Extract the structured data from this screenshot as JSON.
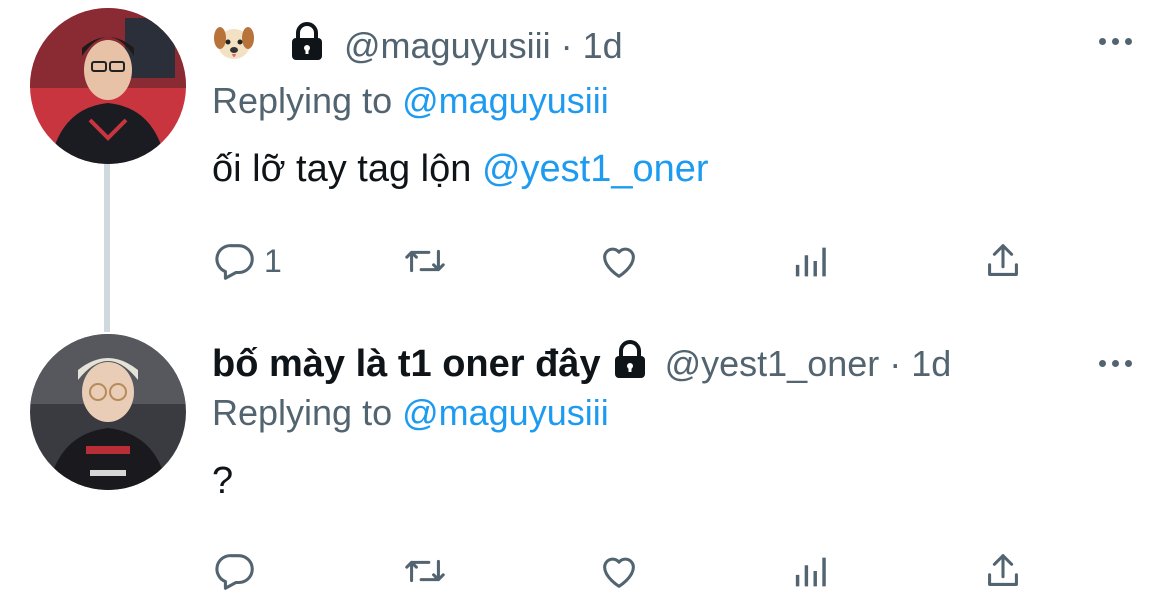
{
  "tweets": [
    {
      "display_name": "",
      "handle": "@maguyusiii",
      "time_sep": " · ",
      "time": "1d",
      "replying_prefix": "Replying to ",
      "replying_to": "@maguyusiii",
      "text_plain": "ối lỡ tay tag lộn ",
      "text_mention": "@yest1_oner",
      "reply_count": "1",
      "icons": [
        "puppy-emoji",
        "lock-icon"
      ]
    },
    {
      "display_name": "bố mày là t1 oner đây",
      "handle": "@yest1_oner",
      "time_sep": " · ",
      "time": "1d",
      "replying_prefix": "Replying to ",
      "replying_to": "@maguyusiii",
      "text_plain": "?",
      "text_mention": "",
      "reply_count": "",
      "icons": [
        "lock-icon"
      ]
    }
  ],
  "colors": {
    "link": "#1d9bf0",
    "muted": "#536471",
    "text": "#0f1419",
    "thread_line": "#cfd9de"
  }
}
